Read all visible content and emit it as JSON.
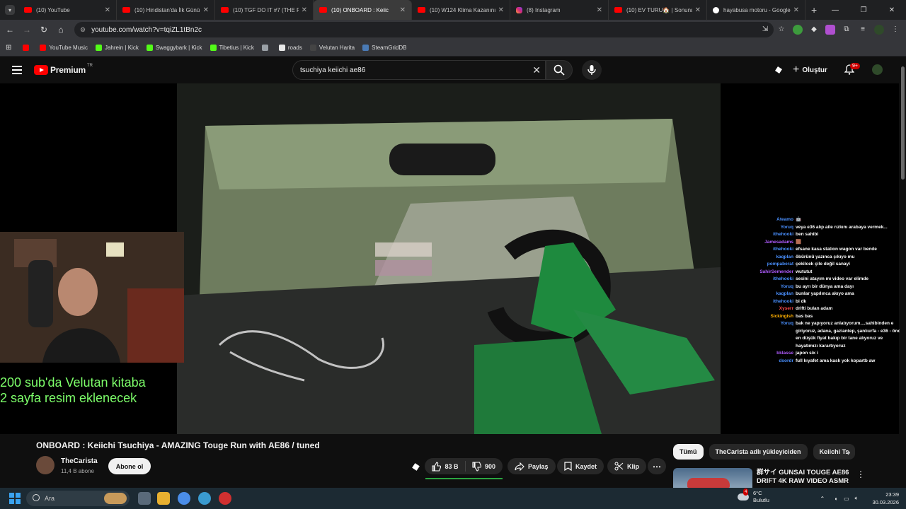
{
  "tabs": [
    {
      "title": "(10) YouTube",
      "type": "yt"
    },
    {
      "title": "(10) Hindistan'da İlk Günü",
      "type": "yt"
    },
    {
      "title": "(10) TGF DO IT #7 (THE RE",
      "type": "yt"
    },
    {
      "title": "(10) ONBOARD : Keiic",
      "type": "yt",
      "active": true
    },
    {
      "title": "(10) W124 Klima Kazanını",
      "type": "yt"
    },
    {
      "title": "(8) Instagram",
      "type": "ig"
    },
    {
      "title": "(10) EV TURU🏠 | Sonunda",
      "type": "yt"
    },
    {
      "title": "hayabusa motoru - Google",
      "type": "g"
    }
  ],
  "address": {
    "url": "youtube.com/watch?v=tqiZL1tBn2c"
  },
  "bookmarks": [
    {
      "label": "",
      "color": "#ff0000"
    },
    {
      "label": "YouTube Music",
      "color": "#ff0000"
    },
    {
      "label": "Jahrein | Kick",
      "color": "#53fc18"
    },
    {
      "label": "Swaggybark | Kick",
      "color": "#53fc18"
    },
    {
      "label": "Tibetius | Kick",
      "color": "#53fc18"
    },
    {
      "label": "",
      "color": "#9aa0a6"
    },
    {
      "label": "roads",
      "color": "#e8e8e8"
    },
    {
      "label": "Velutan Harita",
      "color": "#444444"
    },
    {
      "label": "SteamGridDB",
      "color": "#4a7ab5"
    }
  ],
  "header": {
    "logo_text": "Premium",
    "region": "TR",
    "search_query": "tsuchiya keiichi ae86",
    "create_label": "Oluştur",
    "notifications": "9+"
  },
  "stream_overlay": {
    "text": "200 sub'da Velutan kitaba\n 2 sayfa resim eklenecek"
  },
  "chat": [
    {
      "user": "Ateamo",
      "msg": "🤖",
      "color": "#4a90ff"
    },
    {
      "user": "Yoruq",
      "msg": "veya e36 alıp aile rızkını arabaya vermek...",
      "color": "#4a90ff"
    },
    {
      "user": "ithehooki",
      "msg": "ben sahibi",
      "color": "#4a90ff"
    },
    {
      "user": "Jamesadams",
      "msg": "🟫",
      "color": "#b05cff"
    },
    {
      "user": "ithehooki",
      "msg": "efsane kasa station wagon var bende",
      "color": "#4a90ff"
    },
    {
      "user": "kaqplan",
      "msg": "öbürünü yazınca çıkıyo mu",
      "color": "#4a90ff"
    },
    {
      "user": "pompaberat",
      "msg": "çekilcek çile değil sanayi",
      "color": "#4a90ff"
    },
    {
      "user": "SahirSemender",
      "msg": "wututut",
      "color": "#b05cff"
    },
    {
      "user": "ithehooki",
      "msg": "sesini atayım mı video var elimde",
      "color": "#4a90ff"
    },
    {
      "user": "Yoruq",
      "msg": "bu ayrı bir dünya ama dayı",
      "color": "#4a90ff"
    },
    {
      "user": "kaqplan",
      "msg": "bunlar yapılınca akıyo ama",
      "color": "#4a90ff"
    },
    {
      "user": "ithehooki",
      "msg": "bi dk",
      "color": "#4a90ff"
    },
    {
      "user": "Xyserr",
      "msg": "drifti bulan adam",
      "color": "#ff4a4a"
    },
    {
      "user": "Sickingish",
      "msg": "bas bas",
      "color": "#ffb000"
    },
    {
      "user": "Yoruq",
      "msg": "bak ne yapıyoruz anlatıyorum....sahibinden e giriyoruz, adana, gaziantep, şanlıurfa - e36 - önce en düşük fiyat bakıp bir tane alıyoruz ve hayatımızı karartıyoruz",
      "color": "#4a90ff"
    },
    {
      "user": "bklasse",
      "msg": "japon six i",
      "color": "#b05cff"
    },
    {
      "user": "dsordr",
      "msg": "full kıyafet ama kask yok kopartb aw",
      "color": "#4a90ff"
    }
  ],
  "video": {
    "title": "ONBOARD : Keiichi Tsuchiya - AMAZING Touge Run with AE86 / tuned",
    "channel": "TheCarista",
    "subscribers": "11,4 B abone",
    "subscribe_label": "Abone ol",
    "likes": "83 B",
    "dislikes": "900",
    "share_label": "Paylaş",
    "save_label": "Kaydet",
    "clip_label": "Klip"
  },
  "chips": [
    "Tümü",
    "TheCarista adlı yükleyiciden",
    "Keiichi Ts"
  ],
  "recommendation": {
    "title": "群サイ GUNSAI TOUGE AE86 DRIFT 4K RAW VIDEO ASMR ..."
  },
  "taskbar": {
    "search_placeholder": "Ara",
    "weather_temp": "6°C",
    "weather_desc": "Bulutlu",
    "weather_alert": "4",
    "time": "23:39",
    "date": "30.03.2026"
  }
}
